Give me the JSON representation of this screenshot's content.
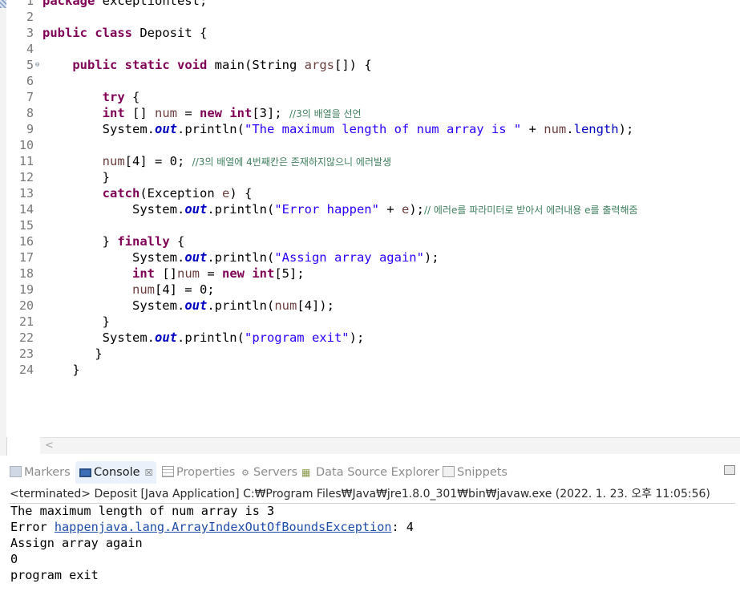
{
  "editor": {
    "lines": [
      {
        "n": "1",
        "seg": [
          [
            "kw",
            "package"
          ],
          [
            "t",
            " exceptiontest;"
          ]
        ]
      },
      {
        "n": "2",
        "seg": []
      },
      {
        "n": "3",
        "seg": [
          [
            "kw",
            "public"
          ],
          [
            "t",
            " "
          ],
          [
            "kw",
            "class"
          ],
          [
            "t",
            " Deposit {"
          ]
        ]
      },
      {
        "n": "4",
        "seg": []
      },
      {
        "n": "5",
        "fold": "⊖",
        "seg": [
          [
            "t",
            "    "
          ],
          [
            "kw",
            "public"
          ],
          [
            "t",
            " "
          ],
          [
            "kw",
            "static"
          ],
          [
            "t",
            " "
          ],
          [
            "kw",
            "void"
          ],
          [
            "t",
            " main(String "
          ],
          [
            "var",
            "args"
          ],
          [
            "t",
            "[]) {"
          ]
        ]
      },
      {
        "n": "6",
        "seg": []
      },
      {
        "n": "7",
        "seg": [
          [
            "t",
            "        "
          ],
          [
            "kw",
            "try"
          ],
          [
            "t",
            " {"
          ]
        ]
      },
      {
        "n": "8",
        "seg": [
          [
            "t",
            "        "
          ],
          [
            "kw",
            "int"
          ],
          [
            "t",
            " [] "
          ],
          [
            "var",
            "num"
          ],
          [
            "t",
            " = "
          ],
          [
            "kw",
            "new"
          ],
          [
            "t",
            " "
          ],
          [
            "kw",
            "int"
          ],
          [
            "t",
            "[3]; "
          ],
          [
            "cm",
            "//3의 배열을 선언"
          ]
        ]
      },
      {
        "n": "9",
        "seg": [
          [
            "t",
            "        System."
          ],
          [
            "fld",
            "out"
          ],
          [
            "t",
            ".println("
          ],
          [
            "str",
            "\"The maximum length of num array is \""
          ],
          [
            "t",
            " + "
          ],
          [
            "var",
            "num"
          ],
          [
            "t",
            "."
          ],
          [
            "fld2",
            "length"
          ],
          [
            "t",
            ");"
          ]
        ]
      },
      {
        "n": "10",
        "seg": []
      },
      {
        "n": "11",
        "seg": [
          [
            "t",
            "        "
          ],
          [
            "var",
            "num"
          ],
          [
            "t",
            "[4] = 0; "
          ],
          [
            "cm",
            "//3의 배열에 4번째칸은 존재하지않으니 에러발생"
          ]
        ]
      },
      {
        "n": "12",
        "seg": [
          [
            "t",
            "        }"
          ]
        ]
      },
      {
        "n": "13",
        "seg": [
          [
            "t",
            "        "
          ],
          [
            "kw",
            "catch"
          ],
          [
            "t",
            "(Exception "
          ],
          [
            "var",
            "e"
          ],
          [
            "t",
            ") {"
          ]
        ]
      },
      {
        "n": "14",
        "seg": [
          [
            "t",
            "            System."
          ],
          [
            "fld",
            "out"
          ],
          [
            "t",
            ".println("
          ],
          [
            "str",
            "\"Error happen\""
          ],
          [
            "t",
            " + "
          ],
          [
            "var",
            "e"
          ],
          [
            "t",
            ");"
          ],
          [
            "cm",
            "// 에러e를 파라미터로 받아서 에러내용 e를 출력해줌"
          ]
        ]
      },
      {
        "n": "15",
        "seg": []
      },
      {
        "n": "16",
        "seg": [
          [
            "t",
            "        } "
          ],
          [
            "kw",
            "finally"
          ],
          [
            "t",
            " {"
          ]
        ]
      },
      {
        "n": "17",
        "seg": [
          [
            "t",
            "            System."
          ],
          [
            "fld",
            "out"
          ],
          [
            "t",
            ".println("
          ],
          [
            "str",
            "\"Assign array again\""
          ],
          [
            "t",
            ");"
          ]
        ]
      },
      {
        "n": "18",
        "seg": [
          [
            "t",
            "            "
          ],
          [
            "kw",
            "int"
          ],
          [
            "t",
            " []"
          ],
          [
            "var",
            "num"
          ],
          [
            "t",
            " = "
          ],
          [
            "kw",
            "new"
          ],
          [
            "t",
            " "
          ],
          [
            "kw",
            "int"
          ],
          [
            "t",
            "[5];"
          ]
        ]
      },
      {
        "n": "19",
        "seg": [
          [
            "t",
            "            "
          ],
          [
            "var",
            "num"
          ],
          [
            "t",
            "[4] = 0;"
          ]
        ]
      },
      {
        "n": "20",
        "seg": [
          [
            "t",
            "            System."
          ],
          [
            "fld",
            "out"
          ],
          [
            "t",
            ".println("
          ],
          [
            "var",
            "num"
          ],
          [
            "t",
            "[4]);"
          ]
        ]
      },
      {
        "n": "21",
        "seg": [
          [
            "t",
            "        }"
          ]
        ]
      },
      {
        "n": "22",
        "seg": [
          [
            "t",
            "        System."
          ],
          [
            "fld",
            "out"
          ],
          [
            "t",
            ".println("
          ],
          [
            "str",
            "\"program exit\""
          ],
          [
            "t",
            ");"
          ]
        ]
      },
      {
        "n": "23",
        "seg": [
          [
            "t",
            "       }"
          ]
        ]
      },
      {
        "n": "24",
        "seg": [
          [
            "t",
            "    }"
          ]
        ]
      }
    ],
    "scroll_left_glyph": "<"
  },
  "tabs": [
    {
      "label": "Markers",
      "icon": "markers-icon",
      "active": false
    },
    {
      "label": "Console",
      "icon": "console-icon",
      "active": true,
      "close": "☒"
    },
    {
      "label": "Properties",
      "icon": "properties-icon",
      "active": false
    },
    {
      "label": "Servers",
      "icon": "servers-icon",
      "active": false
    },
    {
      "label": "Data Source Explorer",
      "icon": "data-source-icon",
      "active": false
    },
    {
      "label": "Snippets",
      "icon": "snippets-icon",
      "active": false
    }
  ],
  "console": {
    "header": "<terminated> Deposit [Java Application] C:₩Program Files₩Java₩jre1.8.0_301₩bin₩javaw.exe  (2022. 1. 23. 오후 11:05:56)",
    "line1": "The maximum length of num array is 3",
    "line2_prefix": "Error ",
    "line2_link": "happenjava.lang.ArrayIndexOutOfBoundsException",
    "line2_suffix": ": 4",
    "line3": "Assign array again",
    "line4": "0",
    "line5": "program exit"
  },
  "colors": {
    "keyword": "#7f0055",
    "string": "#2a00ff",
    "comment": "#3f7f5f",
    "field": "#0000c0",
    "local": "#6a3e3e",
    "link": "#1f4ca8"
  }
}
